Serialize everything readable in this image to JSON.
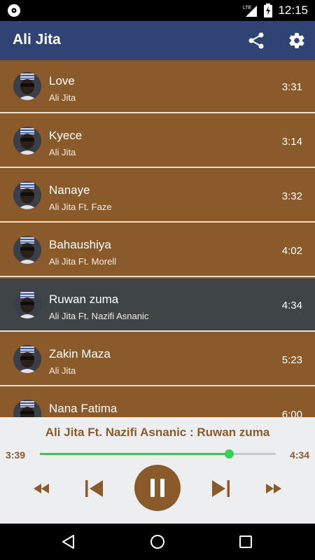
{
  "status_bar": {
    "time": "12:15",
    "network": "LTE",
    "icons": [
      "notification-disc-icon",
      "signal-icon",
      "battery-charging-icon"
    ]
  },
  "app_bar": {
    "title": "Ali Jita",
    "actions": [
      "share-icon",
      "gear-icon"
    ]
  },
  "songs": [
    {
      "title": "Love",
      "artist": "Ali Jita",
      "duration": "3:31",
      "active": false
    },
    {
      "title": "Kyece",
      "artist": "Ali Jita",
      "duration": "3:14",
      "active": false
    },
    {
      "title": "Nanaye",
      "artist": "Ali Jita Ft. Faze",
      "duration": "3:32",
      "active": false
    },
    {
      "title": "Bahaushiya",
      "artist": "Ali Jita Ft. Morell",
      "duration": "4:02",
      "active": false
    },
    {
      "title": "Ruwan zuma",
      "artist": "Ali Jita Ft. Nazifi Asnanic",
      "duration": "4:34",
      "active": true
    },
    {
      "title": "Zakin Maza",
      "artist": "Ali Jita",
      "duration": "5:23",
      "active": false
    },
    {
      "title": "Nana Fatima",
      "artist": "",
      "duration": "6:00",
      "active": false
    }
  ],
  "player": {
    "now_playing": "Ali Jita Ft. Nazifi Asnanic : Ruwan zuma",
    "elapsed": "3:39",
    "total": "4:34",
    "progress": 0.8
  },
  "colors": {
    "app_bar": "#2f4375",
    "list_item": "#8b5a2b",
    "list_item_active": "#3f4546",
    "accent": "#8b5a2b",
    "progress": "#33c653"
  }
}
